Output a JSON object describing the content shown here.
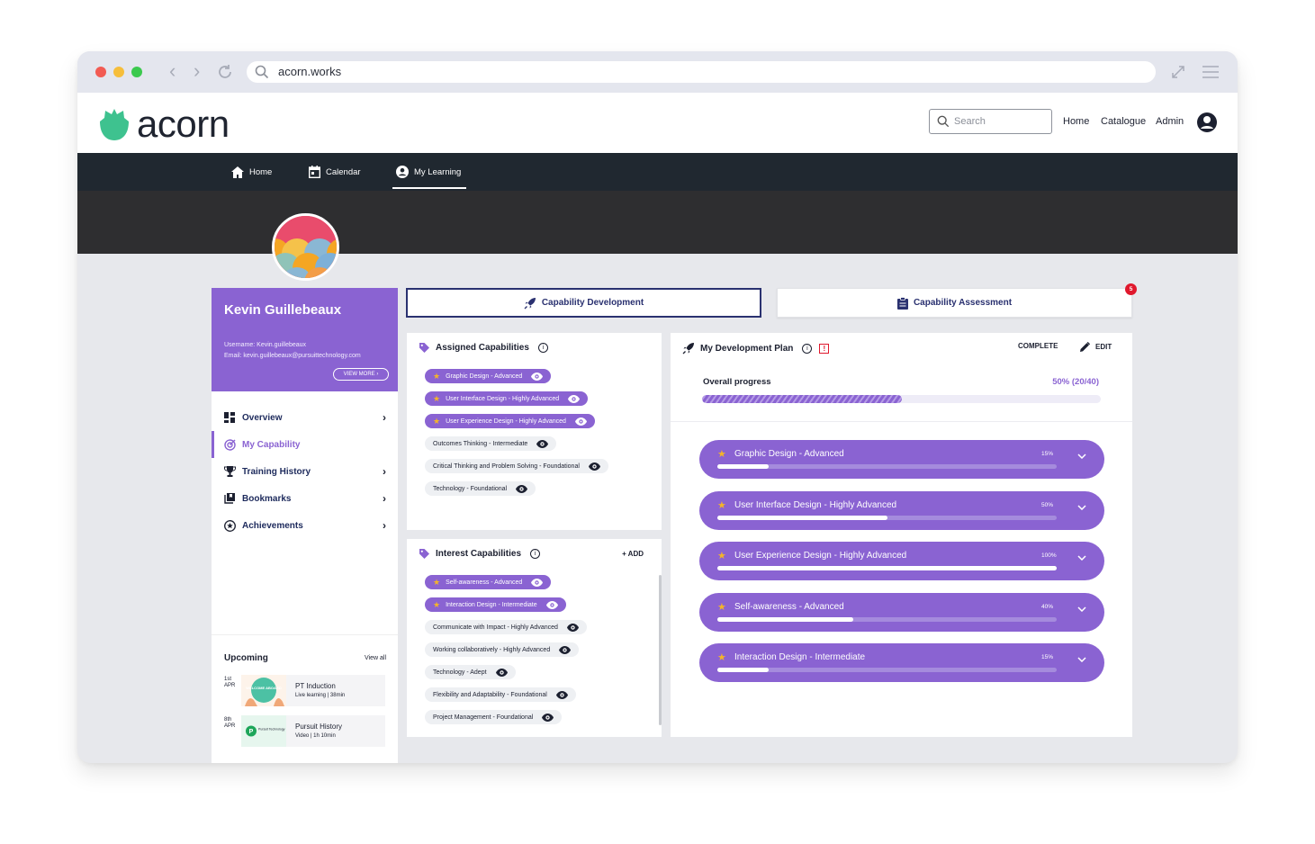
{
  "browser": {
    "url": "acorn.works"
  },
  "header": {
    "brand": "acorn",
    "search_placeholder": "Search",
    "links": [
      "Home",
      "Catalogue",
      "Admin"
    ]
  },
  "nav": {
    "items": [
      "Home",
      "Calendar",
      "My Learning"
    ],
    "active": "My Learning"
  },
  "profile": {
    "name": "Kevin Guillebeaux",
    "username": "Username: Kevin.guillebeaux",
    "email": "Email: kevin.guillebeaux@pursuittechnology.com",
    "view_more": "VIEW MORE"
  },
  "menu": {
    "items": [
      {
        "label": "Overview"
      },
      {
        "label": "My Capability"
      },
      {
        "label": "Training History"
      },
      {
        "label": "Bookmarks"
      },
      {
        "label": "Achievements"
      }
    ]
  },
  "upcoming": {
    "title": "Upcoming",
    "view_all": "View all",
    "events": [
      {
        "day": "1st",
        "month": "APR",
        "title": "PT Induction",
        "meta": "Live learning  |  38min",
        "thumb": "WELCOME ABOARD"
      },
      {
        "day": "8th",
        "month": "APR",
        "title": "Pursuit History",
        "meta": "Video  |  1h 10min",
        "thumb": "Pursuit Technology"
      }
    ]
  },
  "tabs": {
    "development": "Capability Development",
    "assessment": "Capability Assessment",
    "assessment_badge": "5"
  },
  "assigned": {
    "title": "Assigned Capabilities",
    "chips": [
      {
        "label": "Graphic Design - Advanced",
        "starred": true
      },
      {
        "label": "User Interface Design - Highly Advanced",
        "starred": true
      },
      {
        "label": "User Experience Design - Highly Advanced",
        "starred": true
      },
      {
        "label": "Outcomes Thinking - Intermediate",
        "starred": false
      },
      {
        "label": "Critical Thinking and Problem Solving - Foundational",
        "starred": false
      },
      {
        "label": "Technology - Foundational",
        "starred": false
      }
    ]
  },
  "interest": {
    "title": "Interest Capabilities",
    "add": "+ ADD",
    "chips": [
      {
        "label": "Self-awareness - Advanced",
        "starred": true
      },
      {
        "label": "Interaction Design - Intermediate",
        "starred": true
      },
      {
        "label": "Communicate with Impact - Highly Advanced",
        "starred": false
      },
      {
        "label": "Working collaboratively - Highly Advanced",
        "starred": false
      },
      {
        "label": "Technology - Adept",
        "starred": false
      },
      {
        "label": "Flexibility and Adaptability - Foundational",
        "starred": false
      },
      {
        "label": "Project Management - Foundational",
        "starred": false
      }
    ]
  },
  "plan": {
    "title": "My Development Plan",
    "alert": "!",
    "complete": "COMPLETE",
    "edit": "EDIT",
    "overall_label": "Overall progress",
    "overall_value": "50% (20/40)",
    "overall_fraction": 0.5,
    "items": [
      {
        "label": "Graphic Design - Advanced",
        "percent_text": "15%",
        "progress": 0.15
      },
      {
        "label": "User Interface Design - Highly Advanced",
        "percent_text": "50%",
        "progress": 0.5
      },
      {
        "label": "User Experience Design - Highly Advanced",
        "percent_text": "100%",
        "progress": 1.0
      },
      {
        "label": "Self-awareness - Advanced",
        "percent_text": "40%",
        "progress": 0.4
      },
      {
        "label": "Interaction Design - Intermediate",
        "percent_text": "15%",
        "progress": 0.15
      }
    ]
  },
  "colors": {
    "accent": "#8a63d2",
    "brand_green": "#3ec28f",
    "navbar": "#202830",
    "star": "#f4b42a",
    "alert": "#e0182d"
  }
}
